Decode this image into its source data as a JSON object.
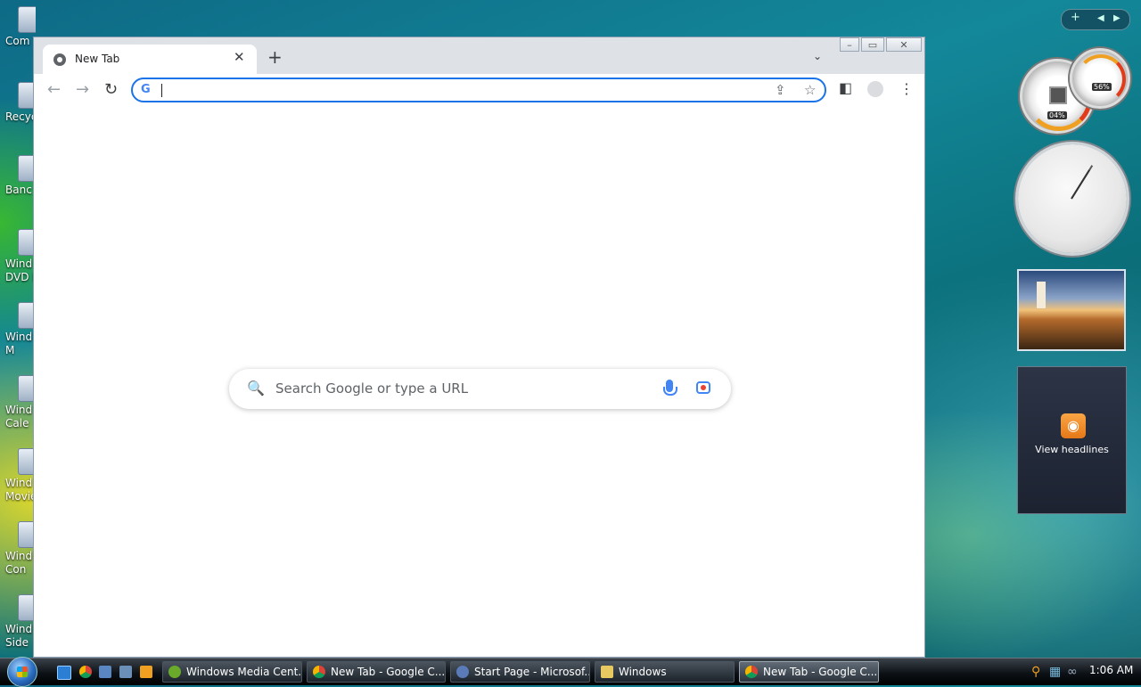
{
  "desktop": {
    "icons": [
      {
        "label": "Com"
      },
      {
        "label": "Recyc"
      },
      {
        "label": "Banc"
      },
      {
        "label": "Wind",
        "label2": "DVD M"
      },
      {
        "label": "Wind",
        "label2": "M"
      },
      {
        "label": "Wind",
        "label2": "Cale"
      },
      {
        "label": "Wind",
        "label2": "Movie"
      },
      {
        "label": "Wind",
        "label2": "Con"
      },
      {
        "label": "Wind",
        "label2": "Side"
      }
    ]
  },
  "browser": {
    "tab_title": "New Tab",
    "new_tab_symbol": "+",
    "close_symbol": "✕",
    "omnibox_value": "",
    "ntp_search_placeholder": "Search Google or type a URL"
  },
  "gadgets": {
    "cpu_percent": "04%",
    "memory_percent": "56%",
    "feed_label": "View headlines"
  },
  "taskbar": {
    "buttons": [
      {
        "label": "Windows Media Cent...",
        "icon_color": "#6aaa2a"
      },
      {
        "label": "New Tab - Google C...",
        "icon_color": "#db4437"
      },
      {
        "label": "Start Page - Microsof...",
        "icon_color": "#5a7ab8"
      },
      {
        "label": "Windows",
        "icon_color": "#e8c860"
      },
      {
        "label": "New Tab - Google C...",
        "icon_color": "#db4437",
        "active": true
      }
    ],
    "time": "1:06 AM"
  },
  "colors": {
    "accent": "#1a73e8",
    "rss": "#f39a30"
  }
}
